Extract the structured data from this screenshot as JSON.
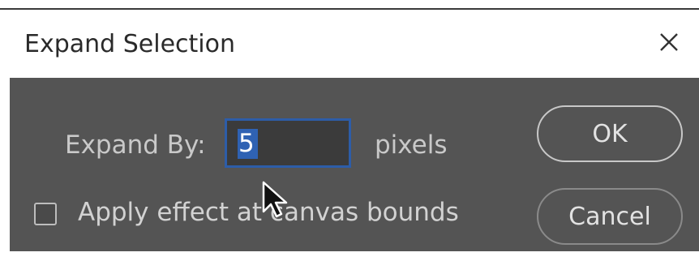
{
  "dialog": {
    "title": "Expand Selection",
    "expand_label": "Expand By:",
    "expand_value": "5",
    "unit_label": "pixels",
    "checkbox_label": "Apply effect at canvas bounds",
    "checkbox_checked": false,
    "ok_label": "OK",
    "cancel_label": "Cancel"
  },
  "icons": {
    "close": "close-icon",
    "cursor": "mouse-pointer-icon"
  },
  "colors": {
    "dialog_body": "#545454",
    "input_focus_border": "#2d5da8",
    "selection_highlight": "#2f62b3"
  }
}
